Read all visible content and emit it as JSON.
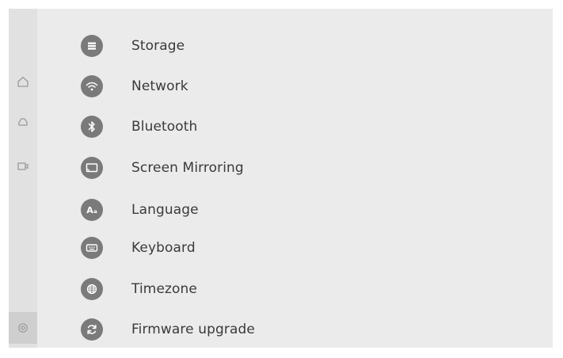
{
  "rail": {
    "items": [
      {
        "icon": "home-icon"
      },
      {
        "icon": "eject-icon"
      },
      {
        "icon": "video-icon"
      },
      {
        "icon": "settings-icon",
        "active": true
      }
    ]
  },
  "menu": {
    "items": [
      {
        "label": "Storage",
        "icon": "storage-icon"
      },
      {
        "label": "Network",
        "icon": "wifi-icon"
      },
      {
        "label": "Bluetooth",
        "icon": "bluetooth-icon"
      },
      {
        "label": "Screen Mirroring",
        "icon": "screen-mirroring-icon"
      },
      {
        "label": "Language",
        "icon": "language-icon",
        "glyph": "Aₐ"
      },
      {
        "label": "Keyboard",
        "icon": "keyboard-icon"
      },
      {
        "label": "Timezone",
        "icon": "globe-icon"
      },
      {
        "label": "Firmware upgrade",
        "icon": "refresh-icon"
      }
    ]
  },
  "colors": {
    "background": "#ebebeb",
    "rail": "#e1e1e1",
    "rail_active": "#cfcfcf",
    "icon_fill": "#7a7a7a",
    "text": "#3a3a3a"
  }
}
